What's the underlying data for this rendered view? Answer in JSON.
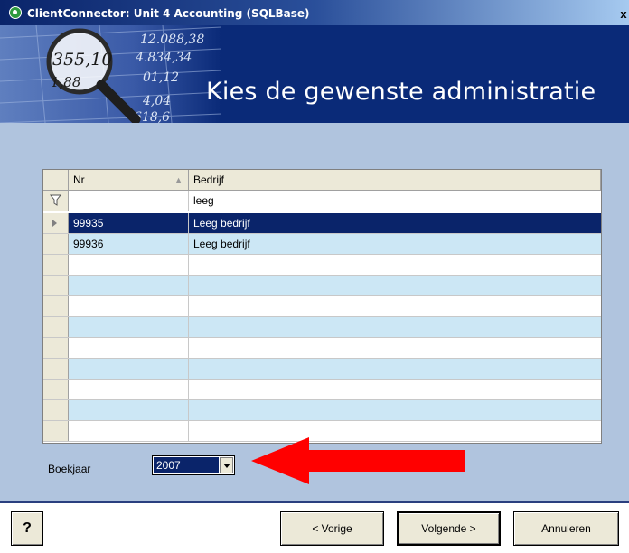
{
  "window": {
    "title": "ClientConnector: Unit 4 Accounting (SQLBase)",
    "close_label": "x"
  },
  "banner": {
    "heading": "Kies de gewenste administratie",
    "image_numbers": [
      "12.088,38",
      "4.834,34",
      "01,12",
      "355,10",
      "1,88",
      "4,04",
      "618,6"
    ]
  },
  "grid": {
    "columns": [
      "Nr",
      "Bedrijf"
    ],
    "filter": {
      "nr": "",
      "bedrijf": "leeg"
    },
    "rows": [
      {
        "nr": "99935",
        "bedrijf": "Leeg bedrijf",
        "selected": true
      },
      {
        "nr": "99936",
        "bedrijf": "Leeg bedrijf",
        "selected": false
      },
      {
        "nr": "",
        "bedrijf": ""
      },
      {
        "nr": "",
        "bedrijf": ""
      },
      {
        "nr": "",
        "bedrijf": ""
      },
      {
        "nr": "",
        "bedrijf": ""
      },
      {
        "nr": "",
        "bedrijf": ""
      },
      {
        "nr": "",
        "bedrijf": ""
      },
      {
        "nr": "",
        "bedrijf": ""
      },
      {
        "nr": "",
        "bedrijf": ""
      },
      {
        "nr": "",
        "bedrijf": ""
      }
    ]
  },
  "boekjaar": {
    "label": "Boekjaar",
    "value": "2007"
  },
  "buttons": {
    "help": "?",
    "back": "< Vorige",
    "next": "Volgende >",
    "cancel": "Annuleren"
  },
  "colors": {
    "title_bar": "#0a246a",
    "banner": "#0a2a78",
    "body": "#b0c4de",
    "selection": "#0a246a",
    "alt_row": "#cce7f5",
    "arrow": "#ff0000"
  }
}
